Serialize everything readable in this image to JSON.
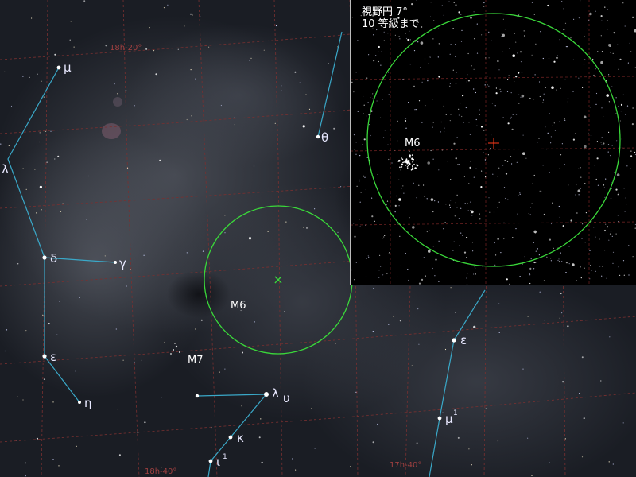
{
  "main_chart": {
    "grid_labels": {
      "ra_top": "18h-20°",
      "ra_bottom_left": "18h-40°",
      "ra_bottom_right": "17h-40°"
    },
    "star_labels": {
      "mu": "μ",
      "lambda_left": "λ",
      "delta": "δ",
      "gamma": "γ",
      "epsilon_left": "ε",
      "eta": "η",
      "theta": "θ",
      "lambda_sco": "λ",
      "upsilon": "υ",
      "kappa": "κ",
      "iota": "ι",
      "iota_sup": "1",
      "epsilon_right": "ε",
      "mu_right": "μ",
      "mu_right_sup": "1"
    },
    "objects": {
      "m6": "M6",
      "m7": "M7"
    },
    "fov_marker": "×",
    "colors": {
      "grid": "#7a3030",
      "constellation": "#3aa8c8",
      "fov_circle": "#3ad83a",
      "background": "#1a1d24"
    }
  },
  "inset": {
    "caption_line1": "視野円 7°",
    "caption_line2": "10 等級まで",
    "object_label": "M6",
    "center_marker": "+",
    "colors": {
      "circle": "#3ad83a",
      "crosshair": "#ff3a1a",
      "grid": "#6a2020"
    }
  }
}
